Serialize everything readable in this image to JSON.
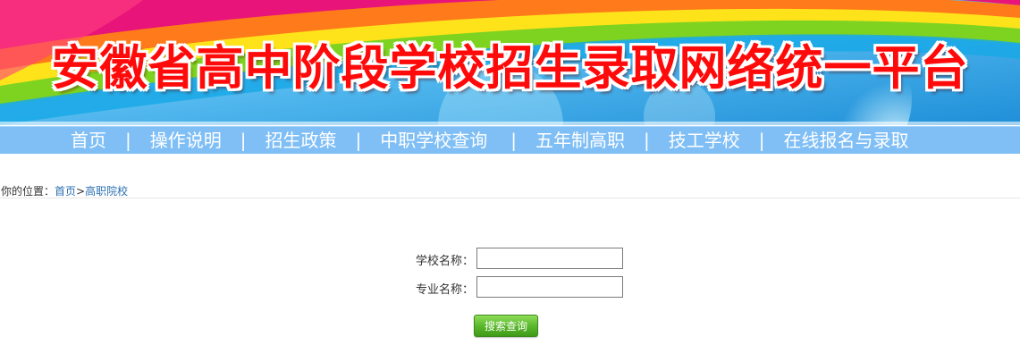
{
  "banner": {
    "title": "安徽省高中阶段学校招生录取网络统一平台",
    "title_color": "#ff0a0a"
  },
  "nav": {
    "background": "#80bff5",
    "items": [
      {
        "label": "首页"
      },
      {
        "label": "操作说明"
      },
      {
        "label": "招生政策"
      },
      {
        "label": "中职学校查询"
      },
      {
        "label": "五年制高职"
      },
      {
        "label": "技工学校"
      },
      {
        "label": "在线报名与录取"
      }
    ],
    "separator": "|"
  },
  "breadcrumb": {
    "prefix": "你的位置：",
    "home": "首页",
    "arrow": ">",
    "current": "高职院校"
  },
  "search_form": {
    "school_label": "学校名称：",
    "school_value": "",
    "major_label": "专业名称：",
    "major_value": "",
    "submit_label": "搜索查询"
  }
}
